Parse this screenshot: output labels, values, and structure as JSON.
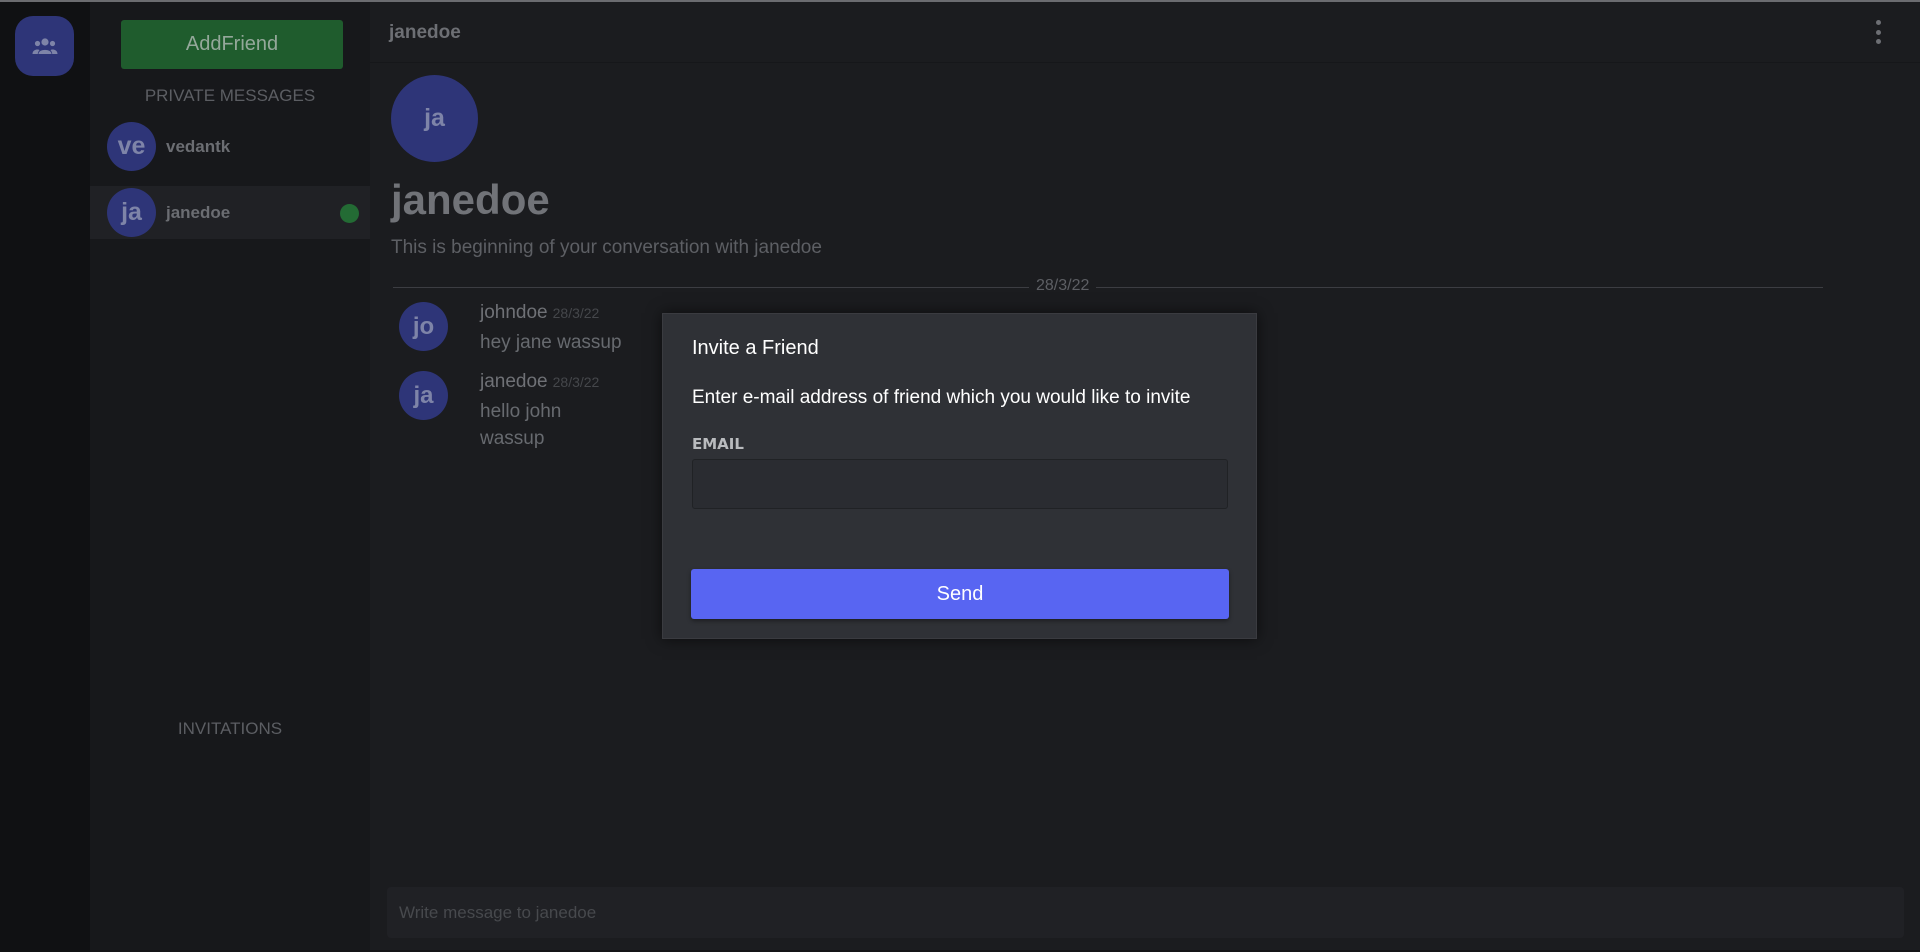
{
  "rail": {
    "friends_icon": "people-group-icon"
  },
  "sidebar": {
    "add_friend_label": "AddFriend",
    "private_messages_label": "PRIVATE MESSAGES",
    "invitations_label": "INVITATIONS",
    "dms": [
      {
        "initials": "ve",
        "name": "vedantk",
        "active": false,
        "online": false
      },
      {
        "initials": "ja",
        "name": "janedoe",
        "active": true,
        "online": true
      }
    ]
  },
  "header": {
    "title": "janedoe",
    "menu_icon": "more-vertical-icon"
  },
  "conversation": {
    "avatar_initials": "ja",
    "name": "janedoe",
    "intro": "This is beginning of your conversation with janedoe",
    "date_divider": "28/3/22",
    "messages": [
      {
        "initials": "jo",
        "author": "johndoe",
        "time": "28/3/22",
        "lines": [
          "hey jane wassup"
        ]
      },
      {
        "initials": "ja",
        "author": "janedoe",
        "time": "28/3/22",
        "lines": [
          "hello john",
          "wassup"
        ]
      }
    ]
  },
  "composer": {
    "placeholder": "Write message to janedoe"
  },
  "modal": {
    "title": "Invite a Friend",
    "description": "Enter e-mail address of friend which you would like to invite",
    "email_label": "EMAIL",
    "email_value": "",
    "send_label": "Send"
  },
  "colors": {
    "accent": "#5865f2",
    "avatar": "#2e3578",
    "online": "#236b34",
    "add_friend": "#1f5c2d"
  }
}
